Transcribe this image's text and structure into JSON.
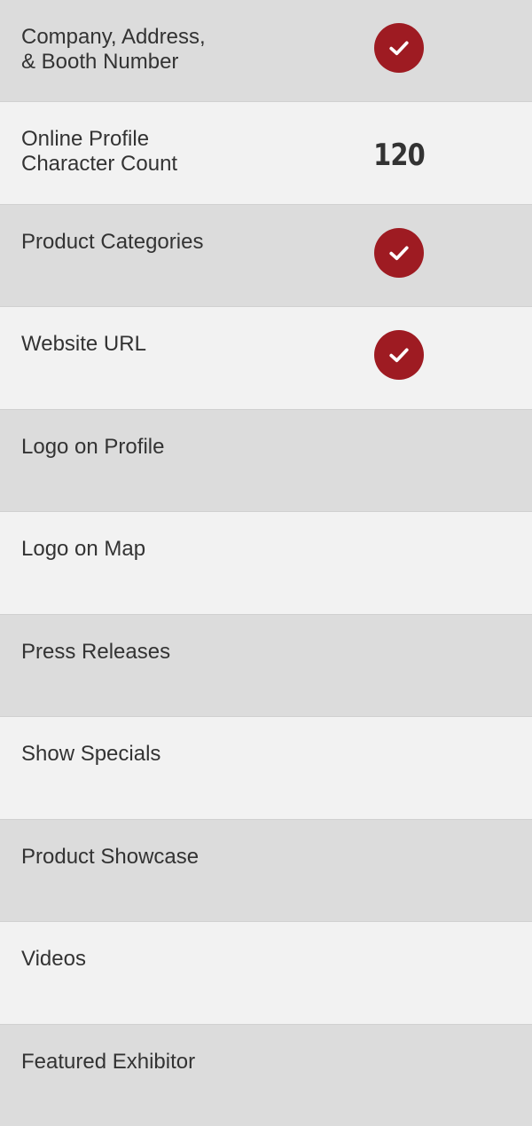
{
  "accent_color": "#9e1b22",
  "rows": [
    {
      "label": "Company, Address,\n& Booth Number",
      "value_type": "check",
      "icon": "checkmark-icon"
    },
    {
      "label": "Online Profile\nCharacter Count",
      "value_type": "text",
      "value": "120"
    },
    {
      "label": "Product Categories",
      "value_type": "check",
      "icon": "checkmark-icon"
    },
    {
      "label": "Website URL",
      "value_type": "check",
      "icon": "checkmark-icon"
    },
    {
      "label": "Logo on Profile",
      "value_type": "none"
    },
    {
      "label": "Logo on Map",
      "value_type": "none"
    },
    {
      "label": "Press Releases",
      "value_type": "none"
    },
    {
      "label": "Show Specials",
      "value_type": "none"
    },
    {
      "label": " Product Showcase",
      "value_type": "none"
    },
    {
      "label": "Videos",
      "value_type": "none"
    },
    {
      "label": "Featured Exhibitor",
      "value_type": "none"
    }
  ]
}
